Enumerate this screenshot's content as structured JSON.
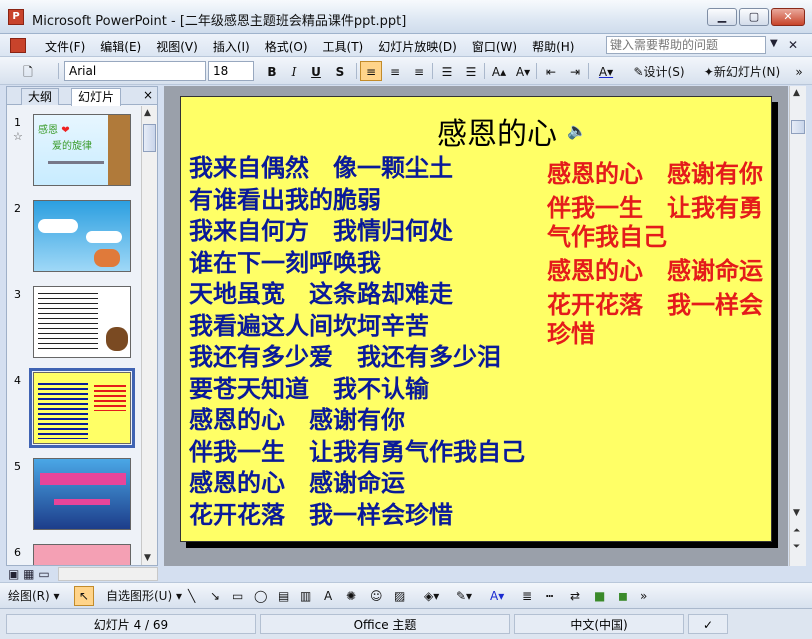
{
  "window": {
    "title": "Microsoft PowerPoint - [二年级感恩主题班会精品课件ppt.ppt]",
    "app_icon": "P"
  },
  "menu": {
    "items": [
      "文件(F)",
      "编辑(E)",
      "视图(V)",
      "插入(I)",
      "格式(O)",
      "工具(T)",
      "幻灯片放映(D)",
      "窗口(W)",
      "帮助(H)"
    ],
    "help_placeholder": "键入需要帮助的问题"
  },
  "toolbar": {
    "font": "Arial",
    "size": "18",
    "bold": "B",
    "italic": "I",
    "underline": "U",
    "shadow": "S",
    "design_label": "设计(S)",
    "new_slide_label": "新幻灯片(N)"
  },
  "left_pane": {
    "tabs": [
      "大纲",
      "幻灯片"
    ],
    "close": "×",
    "thumbnails": [
      {
        "number": "1",
        "star": "☆"
      },
      {
        "number": "2"
      },
      {
        "number": "3"
      },
      {
        "number": "4",
        "selected": true
      },
      {
        "number": "5"
      },
      {
        "number": "6"
      }
    ]
  },
  "slide": {
    "title": "感恩的心",
    "left_lines": [
      "我来自偶然　像一颗尘土",
      "有谁看出我的脆弱",
      "我来自何方　我情归何处",
      "谁在下一刻呼唤我",
      "天地虽宽　这条路却难走",
      "我看遍这人间坎坷辛苦",
      "我还有多少爱　我还有多少泪",
      "要苍天知道　我不认输",
      "感恩的心　感谢有你",
      "伴我一生　让我有勇气作我自己",
      "感恩的心　感谢命运",
      "花开花落　我一样会珍惜"
    ],
    "right_blocks": [
      "感恩的心　感谢有你",
      "伴我一生　让我有勇气作我自己",
      "感恩的心　感谢命运",
      "花开花落　我一样会珍惜"
    ],
    "colors": {
      "background": "#ffff66",
      "left_text": "#0a1a99",
      "right_text": "#e41b1b"
    }
  },
  "drawbar": {
    "draw_label": "绘图(R)",
    "autoshape_label": "自选图形(U)"
  },
  "status": {
    "slide": "幻灯片 4 / 69",
    "theme": "Office 主题",
    "language": "中文(中国)"
  }
}
